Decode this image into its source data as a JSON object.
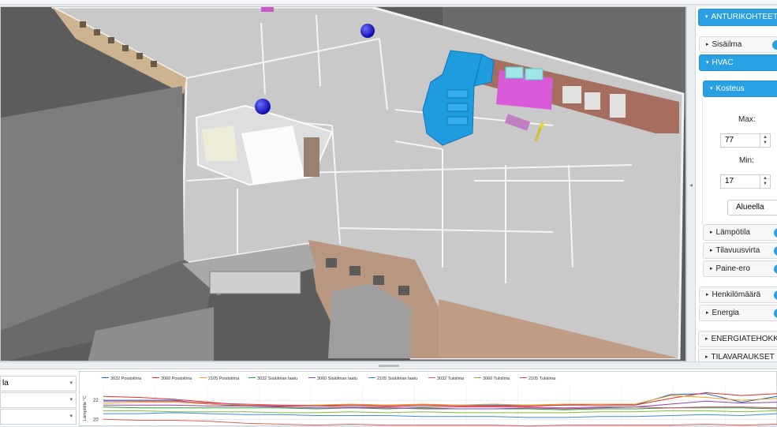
{
  "panel": {
    "header": "ANTURIKOHTEET",
    "items": {
      "sisailma": "Sisäilma",
      "hvac": "HVAC",
      "kosteus": "Kosteus",
      "max_label": "Max:",
      "max_value": "77",
      "min_label": "Min:",
      "min_value": "17",
      "scope_select": "Alueella",
      "lampotila": "Lämpötila",
      "tilavuusvirta": "Tilavuusvirta",
      "paine_ero": "Paine-ero",
      "henkilomaara": "Henkilömäärä",
      "energia": "Energia",
      "energiatehokkuus": "ENERGIATEHOKKUUS",
      "tilavaraukset": "TILAVARAUKSET"
    }
  },
  "bottom": {
    "selects": [
      "la",
      "",
      ""
    ]
  },
  "chart_data": {
    "type": "line",
    "ylabel": "Lämpötila °C",
    "yticks": [
      "22",
      "20"
    ],
    "ylim": [
      19.2,
      23.5
    ],
    "series": [
      {
        "name": "3032 Poistoilma",
        "color": "#1f5fc4",
        "values": [
          22.0,
          22.0,
          22.0,
          21.6,
          21.4,
          21.4,
          21.5,
          21.5,
          21.5,
          21.5,
          21.5,
          21.5,
          21.5,
          21.5,
          21.6,
          21.5,
          22.6,
          22.7,
          21.8,
          22.4
        ]
      },
      {
        "name": "3060 Poistoilma",
        "color": "#e0302a",
        "values": [
          22.4,
          22.3,
          22.1,
          21.8,
          21.5,
          21.4,
          21.4,
          21.5,
          21.4,
          21.5,
          21.4,
          21.4,
          21.4,
          21.5,
          21.5,
          21.5,
          22.2,
          22.8,
          22.5,
          22.7
        ]
      },
      {
        "name": "2105 Poistoilma",
        "color": "#f0a020",
        "values": [
          21.7,
          21.8,
          21.8,
          21.6,
          21.5,
          21.5,
          21.5,
          21.6,
          21.5,
          21.6,
          21.5,
          21.6,
          21.5,
          21.6,
          21.6,
          21.6,
          22.5,
          22.3,
          22.0,
          22.2
        ]
      },
      {
        "name": "3032 Sisäilman laatu",
        "color": "#2ca02c",
        "values": [
          21.3,
          21.2,
          21.2,
          21.2,
          21.2,
          21.2,
          21.1,
          21.2,
          21.1,
          21.2,
          21.1,
          21.1,
          21.1,
          21.0,
          21.1,
          21.1,
          21.2,
          21.2,
          21.2,
          21.1
        ]
      },
      {
        "name": "3060 Sisäilman laatu",
        "color": "#8e44ad",
        "values": [
          21.5,
          21.5,
          21.5,
          21.4,
          21.4,
          21.3,
          21.2,
          21.2,
          21.2,
          21.1,
          21.1,
          21.1,
          21.2,
          21.1,
          21.2,
          21.3,
          21.6,
          21.9,
          21.7,
          21.8
        ]
      },
      {
        "name": "2105 Sisäilman laatu",
        "color": "#3a8dde",
        "values": [
          20.6,
          20.6,
          20.7,
          20.6,
          20.5,
          20.5,
          20.4,
          20.4,
          20.4,
          20.3,
          20.3,
          20.3,
          20.2,
          20.2,
          20.3,
          20.3,
          20.4,
          20.5,
          20.4,
          20.6
        ]
      },
      {
        "name": "3032 Tuloilma",
        "color": "#e06060",
        "values": [
          20.0,
          19.9,
          19.9,
          19.8,
          19.6,
          19.5,
          19.4,
          19.5,
          19.4,
          19.4,
          19.4,
          19.4,
          19.3,
          19.4,
          19.4,
          19.4,
          19.4,
          19.5,
          19.4,
          19.5
        ]
      },
      {
        "name": "3060 Tuloilma",
        "color": "#7cbf30",
        "values": [
          20.9,
          20.9,
          20.8,
          20.8,
          20.8,
          20.7,
          20.7,
          20.8,
          20.7,
          20.8,
          20.7,
          20.7,
          20.7,
          20.7,
          20.8,
          20.8,
          20.9,
          20.9,
          20.8,
          20.9
        ]
      },
      {
        "name": "2105 Tuloilma",
        "color": "#d9437a",
        "values": [
          21.9,
          21.9,
          21.9,
          21.7,
          21.6,
          21.5,
          21.4,
          21.3,
          21.3,
          21.3,
          21.3,
          21.3,
          21.3,
          21.2,
          21.3,
          21.3,
          21.2,
          21.3,
          21.3,
          21.2
        ]
      }
    ]
  }
}
